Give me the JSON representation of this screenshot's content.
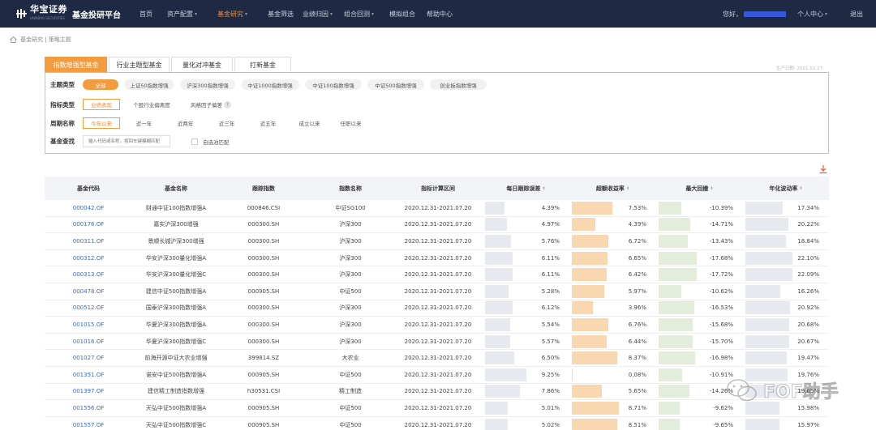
{
  "header": {
    "brand_cn": "华宝证券",
    "brand_en": "HWABAO SECURITIES",
    "platform": "基金投研平台",
    "nav": [
      {
        "label": "首页",
        "dropdown": false,
        "active": false
      },
      {
        "label": "资产配置",
        "dropdown": true,
        "active": false
      },
      {
        "label": "基金研究",
        "dropdown": true,
        "active": true
      },
      {
        "label": "基金筛选",
        "dropdown": false,
        "active": false
      },
      {
        "label": "业绩归因",
        "dropdown": true,
        "active": false
      },
      {
        "label": "组合回测",
        "dropdown": true,
        "active": false
      },
      {
        "label": "模拟组合",
        "dropdown": false,
        "active": false
      },
      {
        "label": "帮助中心",
        "dropdown": false,
        "active": false
      }
    ],
    "greeting": "您好，",
    "user_center": "个人中心",
    "logout": "退出",
    "colors": {
      "bg": "#1e2a44",
      "active": "#f08b3a",
      "accent": "#f39b3f"
    }
  },
  "breadcrumb": "基金研究 | 策略主题",
  "tabs": [
    "指数增强型基金",
    "行业主题型基金",
    "量化对冲基金",
    "打新基金"
  ],
  "update_date": "生产日期: 2021.02.27",
  "filters": {
    "theme": {
      "label": "主题类型",
      "options": [
        "全部",
        "上证50指数增强",
        "沪深300指数增强",
        "中证1000指数增强",
        "中证100指数增强",
        "中证500指数增强",
        "创业板指数增强"
      ]
    },
    "metric": {
      "label": "指标类型",
      "options": [
        "业绩表现",
        "个股行业偏离度",
        "风格因子偏差"
      ]
    },
    "period": {
      "label": "周期名称",
      "options": [
        "今年以来",
        "近一年",
        "近两年",
        "近三年",
        "近五年",
        "成立以来",
        "任职以来"
      ]
    },
    "search": {
      "label": "基金查找",
      "placeholder": "输入代码或名称，按回车键模糊匹配",
      "checkbox_label": "自选池匹配"
    }
  },
  "table": {
    "columns": [
      "基金代码",
      "基金名称",
      "跟踪指数",
      "指数名称",
      "指标计算区间",
      "每日跟踪误差",
      "超额收益率",
      "最大回撤",
      "年化波动率"
    ],
    "rows": [
      [
        "000042.OF",
        "财通中证100指数增强A",
        "000846.CSI",
        "中证SG100",
        "2020.12.31-2021.07.20",
        "4.39%",
        "7.53%",
        "-10.39%",
        "17.34%"
      ],
      [
        "000176.OF",
        "嘉实沪深300增强",
        "000300.SH",
        "沪深300",
        "2020.12.31-2021.07.20",
        "4.97%",
        "4.39%",
        "-14.71%",
        "20.22%"
      ],
      [
        "000311.OF",
        "景顺长城沪深300增强",
        "000300.SH",
        "沪深300",
        "2020.12.31-2021.07.20",
        "5.76%",
        "6.72%",
        "-13.43%",
        "18.84%"
      ],
      [
        "000312.OF",
        "华安沪深300量化增强A",
        "000300.SH",
        "沪深300",
        "2020.12.31-2021.07.20",
        "6.11%",
        "6.65%",
        "-17.68%",
        "22.10%"
      ],
      [
        "000313.OF",
        "华安沪深300量化增强C",
        "000300.SH",
        "沪深300",
        "2020.12.31-2021.07.20",
        "6.11%",
        "6.42%",
        "-17.72%",
        "22.09%"
      ],
      [
        "000478.OF",
        "建信中证500指数增强A",
        "000905.SH",
        "中证500",
        "2020.12.31-2021.07.20",
        "5.28%",
        "5.97%",
        "-10.62%",
        "16.26%"
      ],
      [
        "000512.OF",
        "国泰沪深300指数增强A",
        "000300.SH",
        "沪深300",
        "2020.12.31-2021.07.20",
        "6.12%",
        "3.96%",
        "-16.53%",
        "20.92%"
      ],
      [
        "001015.OF",
        "华夏沪深300指数增强A",
        "000300.SH",
        "沪深300",
        "2020.12.31-2021.07.20",
        "5.54%",
        "6.76%",
        "-15.68%",
        "20.68%"
      ],
      [
        "001016.OF",
        "华夏沪深300指数增强C",
        "000300.SH",
        "沪深300",
        "2020.12.31-2021.07.20",
        "5.57%",
        "6.44%",
        "-15.70%",
        "20.67%"
      ],
      [
        "001027.OF",
        "前海开源中证大农业增强",
        "399814.SZ",
        "大农业",
        "2020.12.31-2021.07.20",
        "6.50%",
        "8.37%",
        "-16.98%",
        "19.47%"
      ],
      [
        "001351.OF",
        "诺安中证500指数增强A",
        "000905.SH",
        "中证500",
        "2020.12.31-2021.07.20",
        "9.25%",
        "0.08%",
        "-10.91%",
        "19.76%"
      ],
      [
        "001397.OF",
        "建信精工制造指数增强",
        "h30531.CSI",
        "精工制造",
        "2020.12.31-2021.07.20",
        "7.86%",
        "5.65%",
        "-14.26%",
        "19.65%"
      ],
      [
        "001556.OF",
        "天弘中证500指数增强A",
        "000905.SH",
        "中证500",
        "2020.12.31-2021.07.20",
        "5.01%",
        "8.71%",
        "-9.62%",
        "15.98%"
      ],
      [
        "001557.OF",
        "天弘中证500指数增强C",
        "000905.SH",
        "中证500",
        "2020.12.31-2021.07.20",
        "5.02%",
        "8.51%",
        "-9.65%",
        "15.97%"
      ]
    ],
    "bar_scale": {
      "tracking_error_max": 12,
      "excess_return_max": 10,
      "drawdown_max": 25,
      "volatility_max": 25
    },
    "bar_colors": {
      "tracking": "#e6e9ee",
      "excess": "#f9d7b0",
      "drawdown": "#e4eddc",
      "volatility": "#e6e9ee"
    }
  },
  "watermark": "FOF助手"
}
